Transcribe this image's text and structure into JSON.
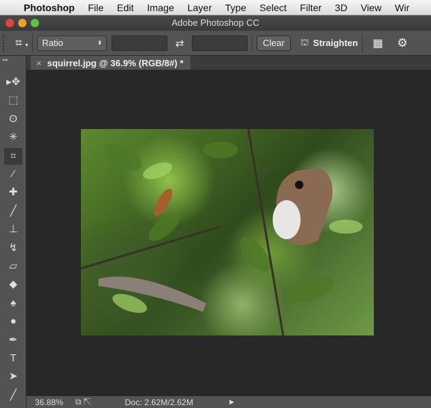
{
  "menubar": {
    "apple": "",
    "app": "Photoshop",
    "items": [
      "File",
      "Edit",
      "Image",
      "Layer",
      "Type",
      "Select",
      "Filter",
      "3D",
      "View",
      "Wir"
    ]
  },
  "window": {
    "title": "Adobe Photoshop CC"
  },
  "options": {
    "ratio": "Ratio",
    "width_value": "",
    "height_value": "",
    "clear": "Clear",
    "straighten": "Straighten"
  },
  "document": {
    "tab_title": "squirrel.jpg @ 36.9% (RGB/8#) *",
    "close": "×"
  },
  "status": {
    "zoom": "36.88%",
    "doc": "Doc: 2.62M/2.62M"
  },
  "tools": [
    {
      "name": "move-tool",
      "glyph": "▸✥"
    },
    {
      "name": "marquee-tool",
      "glyph": "⬚"
    },
    {
      "name": "lasso-tool",
      "glyph": "ʘ"
    },
    {
      "name": "magic-wand-tool",
      "glyph": "✳"
    },
    {
      "name": "crop-tool",
      "glyph": "⌗"
    },
    {
      "name": "eyedropper-tool",
      "glyph": "⁄"
    },
    {
      "name": "healing-brush-tool",
      "glyph": "✚"
    },
    {
      "name": "brush-tool",
      "glyph": "╱"
    },
    {
      "name": "clone-stamp-tool",
      "glyph": "⊥"
    },
    {
      "name": "history-brush-tool",
      "glyph": "↯"
    },
    {
      "name": "eraser-tool",
      "glyph": "▱"
    },
    {
      "name": "paint-bucket-tool",
      "glyph": "◆"
    },
    {
      "name": "blur-tool",
      "glyph": "♠"
    },
    {
      "name": "dodge-tool",
      "glyph": "●"
    },
    {
      "name": "pen-tool",
      "glyph": "✒"
    },
    {
      "name": "type-tool",
      "glyph": "T"
    },
    {
      "name": "path-selection-tool",
      "glyph": "➤"
    },
    {
      "name": "line-tool",
      "glyph": "╱"
    }
  ]
}
